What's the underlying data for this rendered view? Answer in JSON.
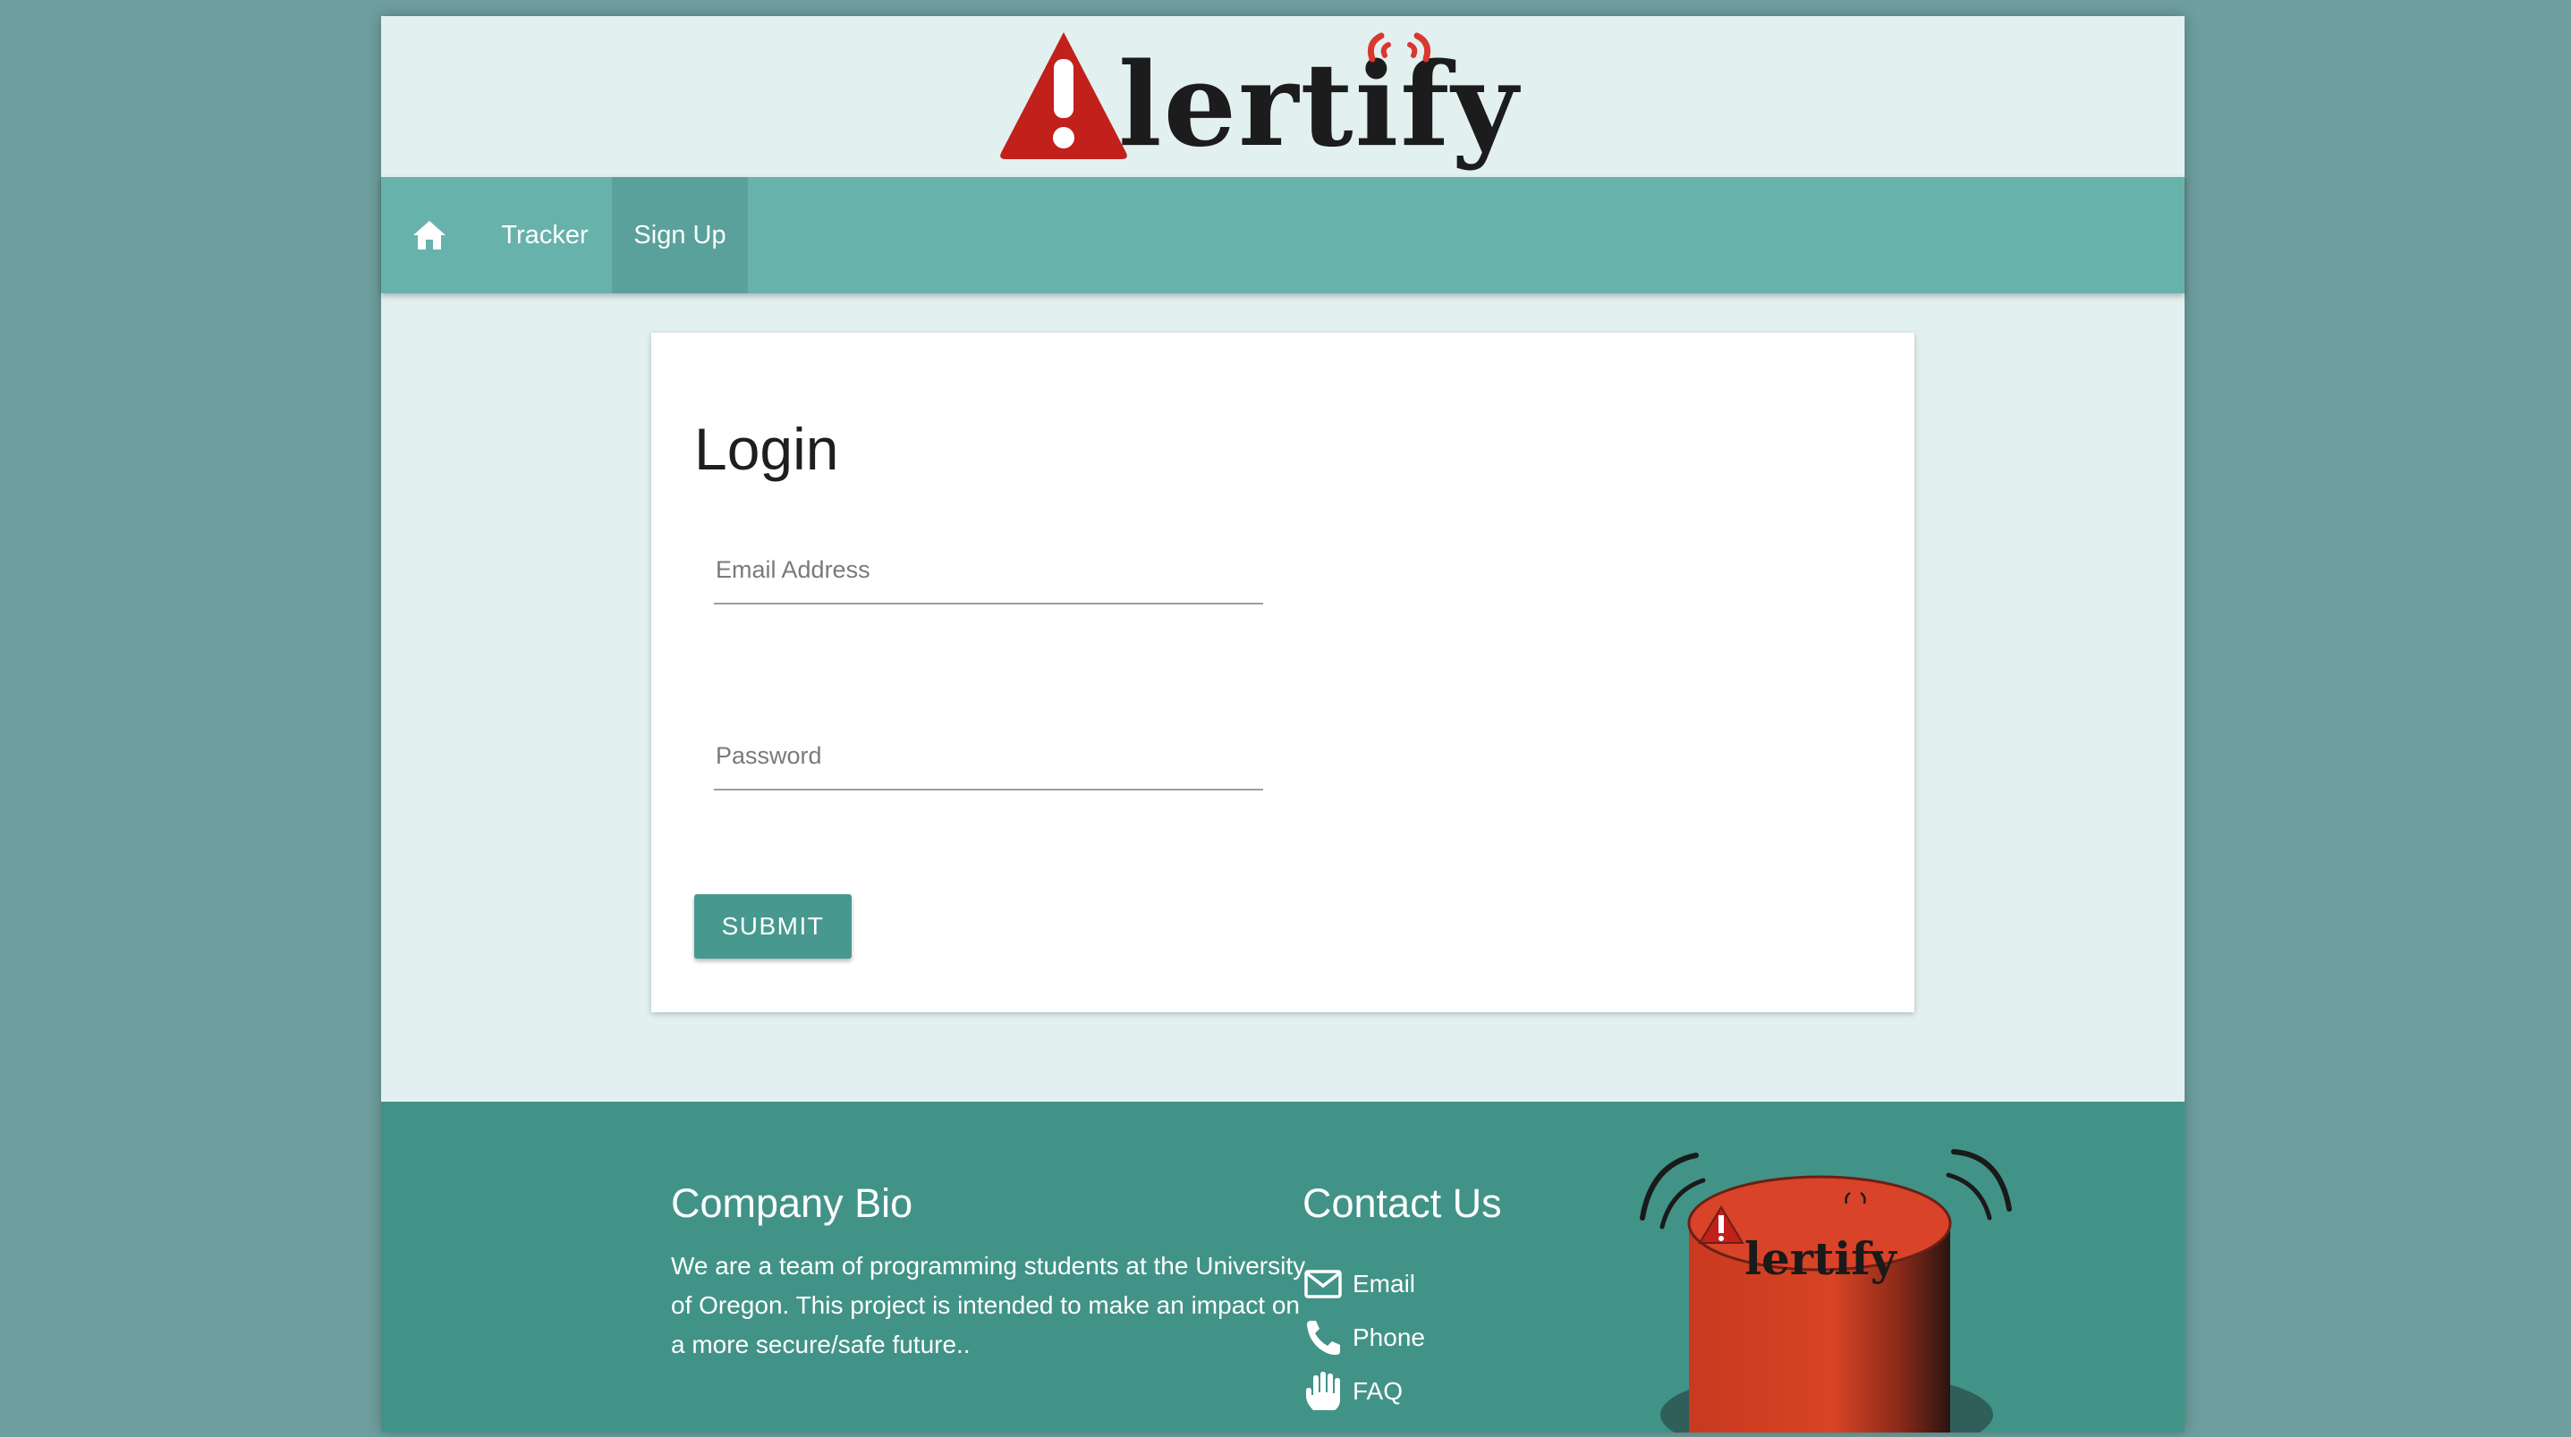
{
  "brand": {
    "logo_text": "lertify"
  },
  "nav": {
    "home_icon": "home-icon",
    "items": [
      {
        "label": "Tracker"
      },
      {
        "label": "Sign Up",
        "active": true
      }
    ]
  },
  "login": {
    "title": "Login",
    "email": {
      "placeholder": "Email Address",
      "value": ""
    },
    "password": {
      "placeholder": "Password",
      "value": ""
    },
    "submit_label": "SUBMIT"
  },
  "footer": {
    "bio": {
      "title": "Company Bio",
      "text": "We are a team of programming students at the University of Oregon. This project is intended to make an impact on a more secure/safe future.."
    },
    "contact": {
      "title": "Contact Us",
      "links": [
        {
          "label": "Email",
          "icon": "envelope-icon"
        },
        {
          "label": "Phone",
          "icon": "phone-icon"
        },
        {
          "label": "FAQ",
          "icon": "hand-icon"
        }
      ]
    },
    "button_art_text": "lertify"
  },
  "colors": {
    "background": "#6e9e9e",
    "page": "#e2f0ef",
    "nav": "#67b3ac",
    "nav_active": "#5aa19b",
    "footer": "#419387",
    "submit": "#47998f",
    "logo_red": "#c1201b"
  }
}
